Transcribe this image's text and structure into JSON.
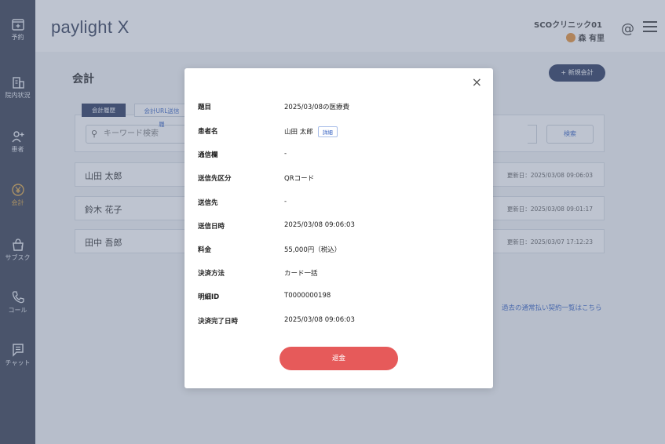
{
  "sidebar": {
    "items": [
      {
        "label": "予約",
        "icon": "calendar-icon"
      },
      {
        "label": "院内状況",
        "icon": "building-icon"
      },
      {
        "label": "患者",
        "icon": "add-user-icon"
      },
      {
        "label": "会計",
        "icon": "yen-coin-icon"
      },
      {
        "label": "サブスク",
        "icon": "bag-icon"
      },
      {
        "label": "コール",
        "icon": "phone-icon"
      },
      {
        "label": "チャット",
        "icon": "chat-icon"
      }
    ]
  },
  "header": {
    "logo": "paylight X",
    "clinic_name": "SCOクリニック01",
    "user_name": "森 有里",
    "at_icon": "@"
  },
  "main": {
    "title": "会計",
    "new_button": "+ 新規会計",
    "tabs": [
      "会計履歴",
      "会計URL送信履"
    ],
    "search": {
      "placeholder": "キーワード検索",
      "button": "検索"
    },
    "rows": [
      {
        "name": "山田 太郎",
        "updated": "更新日：2025/03/08 09:06:03"
      },
      {
        "name": "鈴木 花子",
        "updated": "更新日：2025/03/08 09:01:17"
      },
      {
        "name": "田中 吾郎",
        "updated": "更新日：2025/03/07 17:12:23"
      }
    ],
    "past_link": "過去の通常払い契約一覧はこちら"
  },
  "modal": {
    "close": "×",
    "fields": [
      {
        "label": "題目",
        "value": "2025/03/08の医療費"
      },
      {
        "label": "患者名",
        "value": "山田 太郎",
        "detail": "詳細"
      },
      {
        "label": "通信欄",
        "value": "-"
      },
      {
        "label": "送信先区分",
        "value": "QRコード"
      },
      {
        "label": "送信先",
        "value": "-"
      },
      {
        "label": "送信日時",
        "value": "2025/03/08 09:06:03"
      },
      {
        "label": "料金",
        "value": "55,000円（税込）"
      },
      {
        "label": "決済方法",
        "value": "カード一括"
      },
      {
        "label": "明細ID",
        "value": "T0000000198"
      },
      {
        "label": "決済完了日時",
        "value": "2025/03/08 09:06:03"
      }
    ],
    "refund_button": "返金"
  },
  "colors": {
    "sidebar_bg": "#2c3447",
    "active": "#d9a13c",
    "navy_button": "#1f2f57",
    "refund": "#e65a5a",
    "link": "#2d5bbf"
  }
}
